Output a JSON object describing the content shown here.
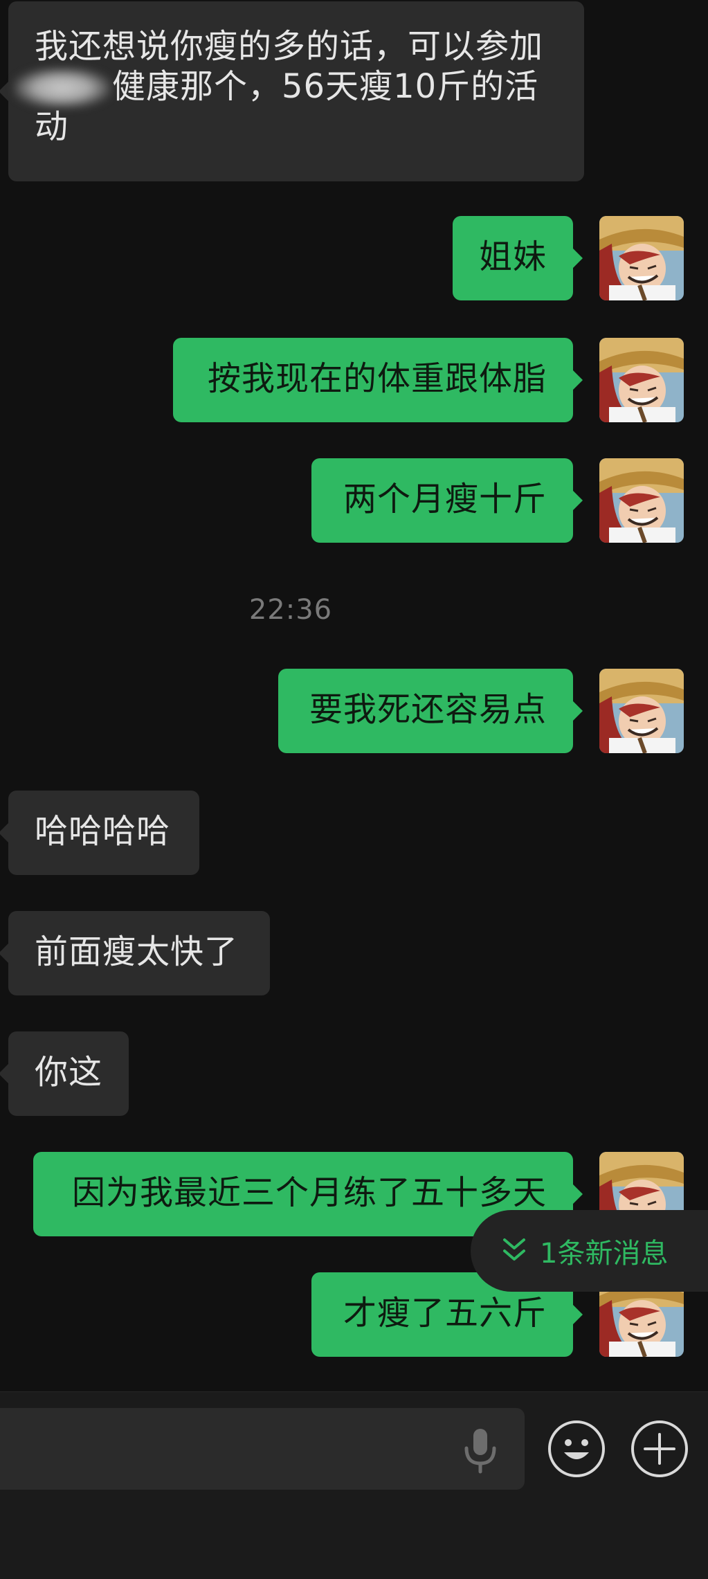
{
  "messages": [
    {
      "id": "m1",
      "side": "in",
      "lines": [
        "我还想说你瘦的多的话，可以参加",
        "健康那个，56天瘦10斤的活",
        "动"
      ]
    },
    {
      "id": "m2",
      "side": "out",
      "text": "姐妹"
    },
    {
      "id": "m3",
      "side": "out",
      "text": "按我现在的体重跟体脂"
    },
    {
      "id": "m4",
      "side": "out",
      "text": "两个月瘦十斤"
    },
    {
      "id": "m5",
      "side": "out",
      "text": "要我死还容易点"
    },
    {
      "id": "m6",
      "side": "in",
      "text": "哈哈哈哈"
    },
    {
      "id": "m7",
      "side": "in",
      "text": "前面瘦太快了"
    },
    {
      "id": "m8",
      "side": "in",
      "text": "你这"
    },
    {
      "id": "m9",
      "side": "out",
      "text": "因为我最近三个月练了五十多天"
    },
    {
      "id": "m10",
      "side": "out",
      "text": "才瘦了五六斤"
    }
  ],
  "timestamp": "22:36",
  "new_message_pill": {
    "label": "1条新消息",
    "icon": "double-chevron-down-icon"
  },
  "input_bar": {
    "mic_icon": "microphone-icon",
    "emoji_icon": "emoji-icon",
    "plus_icon": "plus-icon"
  },
  "colors": {
    "background": "#111111",
    "incoming_bubble": "#2c2c2c",
    "outgoing_bubble": "#2fb962",
    "accent": "#2fb962",
    "timestamp": "#7a7a7a"
  }
}
